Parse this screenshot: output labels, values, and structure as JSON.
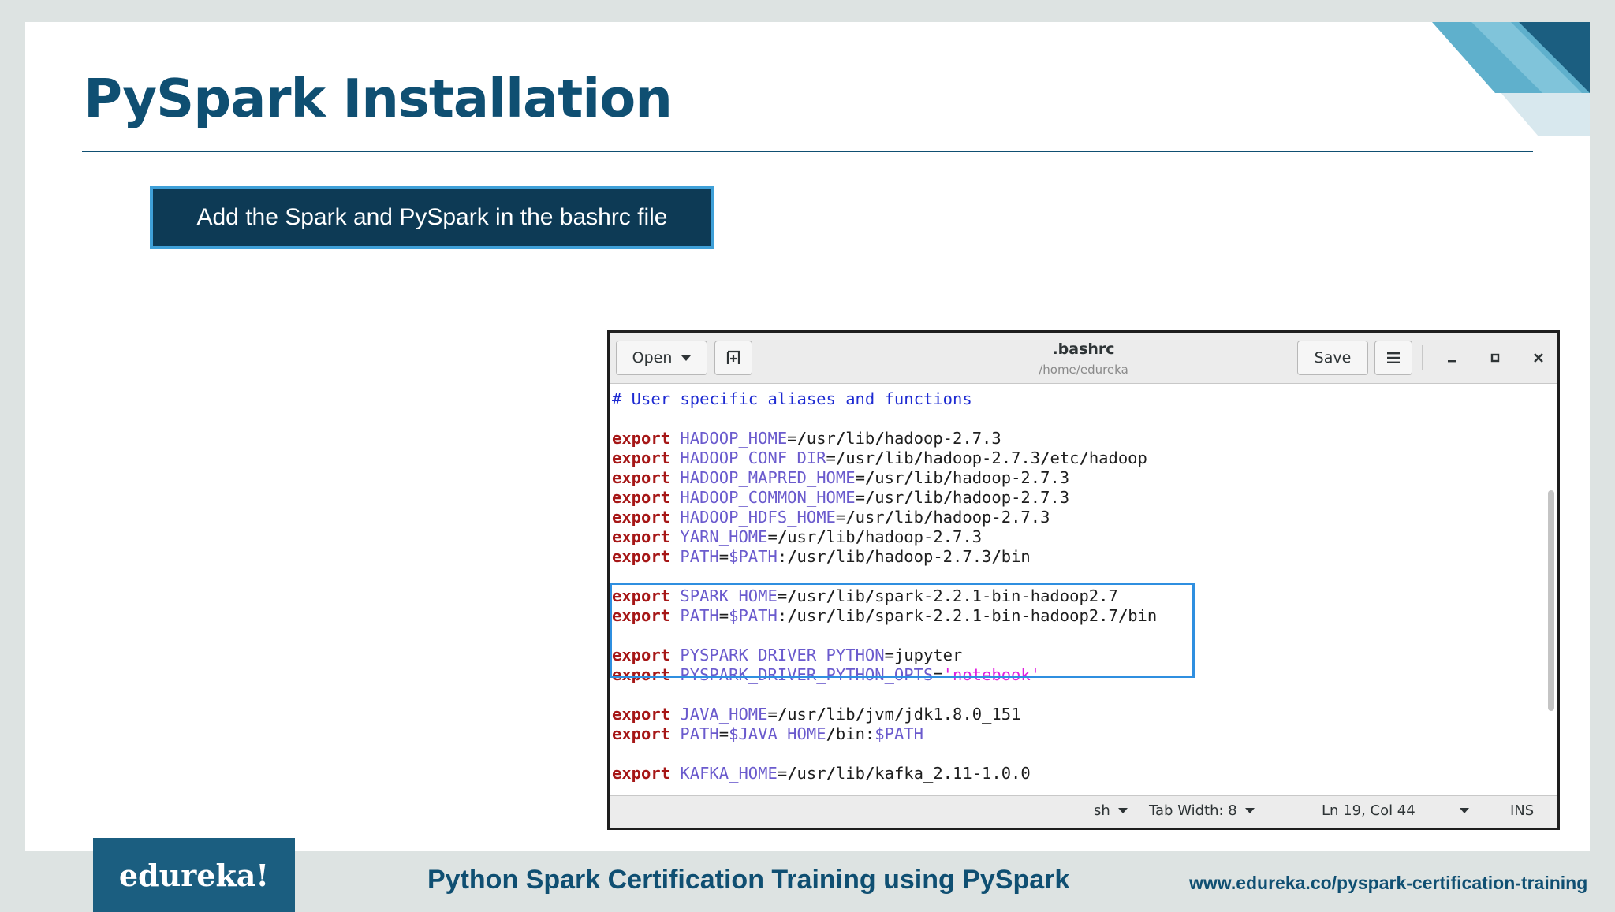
{
  "slide": {
    "title": "PySpark Installation",
    "callout": "Add the Spark and PySpark in the bashrc file"
  },
  "editor": {
    "open_label": "Open",
    "save_label": "Save",
    "new_tab_icon": "new-document-icon",
    "menu_icon": "hamburger-menu-icon",
    "window_title": ".bashrc",
    "window_path": "/home/edureka",
    "window_controls": [
      "minimize",
      "maximize",
      "close"
    ],
    "lines": [
      [
        {
          "t": "# User specific aliases and functions",
          "c": "cm"
        }
      ],
      [],
      [
        {
          "t": "export",
          "c": "kw"
        },
        {
          "t": " "
        },
        {
          "t": "HADOOP_HOME",
          "c": "var"
        },
        {
          "t": "="
        },
        {
          "t": "/",
          "c": "sl"
        },
        {
          "t": "usr"
        },
        {
          "t": "/",
          "c": "sl"
        },
        {
          "t": "lib"
        },
        {
          "t": "/",
          "c": "sl"
        },
        {
          "t": "hadoop-2.7.3"
        }
      ],
      [
        {
          "t": "export",
          "c": "kw"
        },
        {
          "t": " "
        },
        {
          "t": "HADOOP_CONF_DIR",
          "c": "var"
        },
        {
          "t": "="
        },
        {
          "t": "/",
          "c": "sl"
        },
        {
          "t": "usr"
        },
        {
          "t": "/",
          "c": "sl"
        },
        {
          "t": "lib"
        },
        {
          "t": "/",
          "c": "sl"
        },
        {
          "t": "hadoop-2.7.3"
        },
        {
          "t": "/",
          "c": "sl"
        },
        {
          "t": "etc"
        },
        {
          "t": "/",
          "c": "sl"
        },
        {
          "t": "hadoop"
        }
      ],
      [
        {
          "t": "export",
          "c": "kw"
        },
        {
          "t": " "
        },
        {
          "t": "HADOOP_MAPRED_HOME",
          "c": "var"
        },
        {
          "t": "="
        },
        {
          "t": "/",
          "c": "sl"
        },
        {
          "t": "usr"
        },
        {
          "t": "/",
          "c": "sl"
        },
        {
          "t": "lib"
        },
        {
          "t": "/",
          "c": "sl"
        },
        {
          "t": "hadoop-2.7.3"
        }
      ],
      [
        {
          "t": "export",
          "c": "kw"
        },
        {
          "t": " "
        },
        {
          "t": "HADOOP_COMMON_HOME",
          "c": "var"
        },
        {
          "t": "="
        },
        {
          "t": "/",
          "c": "sl"
        },
        {
          "t": "usr"
        },
        {
          "t": "/",
          "c": "sl"
        },
        {
          "t": "lib"
        },
        {
          "t": "/",
          "c": "sl"
        },
        {
          "t": "hadoop-2.7.3"
        }
      ],
      [
        {
          "t": "export",
          "c": "kw"
        },
        {
          "t": " "
        },
        {
          "t": "HADOOP_HDFS_HOME",
          "c": "var"
        },
        {
          "t": "="
        },
        {
          "t": "/",
          "c": "sl"
        },
        {
          "t": "usr"
        },
        {
          "t": "/",
          "c": "sl"
        },
        {
          "t": "lib"
        },
        {
          "t": "/",
          "c": "sl"
        },
        {
          "t": "hadoop-2.7.3"
        }
      ],
      [
        {
          "t": "export",
          "c": "kw"
        },
        {
          "t": " "
        },
        {
          "t": "YARN_HOME",
          "c": "var"
        },
        {
          "t": "="
        },
        {
          "t": "/",
          "c": "sl"
        },
        {
          "t": "usr"
        },
        {
          "t": "/",
          "c": "sl"
        },
        {
          "t": "lib"
        },
        {
          "t": "/",
          "c": "sl"
        },
        {
          "t": "hadoop-2.7.3"
        }
      ],
      [
        {
          "t": "export",
          "c": "kw"
        },
        {
          "t": " "
        },
        {
          "t": "PATH",
          "c": "var"
        },
        {
          "t": "="
        },
        {
          "t": "$PATH",
          "c": "var"
        },
        {
          "t": ":"
        },
        {
          "t": "/",
          "c": "sl"
        },
        {
          "t": "usr"
        },
        {
          "t": "/",
          "c": "sl"
        },
        {
          "t": "lib"
        },
        {
          "t": "/",
          "c": "sl"
        },
        {
          "t": "hadoop-2.7.3"
        },
        {
          "t": "/",
          "c": "sl"
        },
        {
          "t": "bin"
        },
        {
          "t": "",
          "c": "cursor"
        }
      ],
      [],
      [
        {
          "t": "export",
          "c": "kw"
        },
        {
          "t": " "
        },
        {
          "t": "SPARK_HOME",
          "c": "var"
        },
        {
          "t": "="
        },
        {
          "t": "/",
          "c": "sl"
        },
        {
          "t": "usr"
        },
        {
          "t": "/",
          "c": "sl"
        },
        {
          "t": "lib"
        },
        {
          "t": "/",
          "c": "sl"
        },
        {
          "t": "spark-2.2.1-bin-hadoop2.7"
        }
      ],
      [
        {
          "t": "export",
          "c": "kw"
        },
        {
          "t": " "
        },
        {
          "t": "PATH",
          "c": "var"
        },
        {
          "t": "="
        },
        {
          "t": "$PATH",
          "c": "var"
        },
        {
          "t": ":"
        },
        {
          "t": "/",
          "c": "sl"
        },
        {
          "t": "usr"
        },
        {
          "t": "/",
          "c": "sl"
        },
        {
          "t": "lib"
        },
        {
          "t": "/",
          "c": "sl"
        },
        {
          "t": "spark-2.2.1-bin-hadoop2.7"
        },
        {
          "t": "/",
          "c": "sl"
        },
        {
          "t": "bin"
        }
      ],
      [],
      [
        {
          "t": "export",
          "c": "kw"
        },
        {
          "t": " "
        },
        {
          "t": "PYSPARK_DRIVER_PYTHON",
          "c": "var"
        },
        {
          "t": "="
        },
        {
          "t": "jupyter"
        }
      ],
      [
        {
          "t": "export",
          "c": "kw"
        },
        {
          "t": " "
        },
        {
          "t": "PYSPARK_DRIVER_PYTHON_OPTS",
          "c": "var"
        },
        {
          "t": "="
        },
        {
          "t": "'notebook'",
          "c": "str"
        }
      ],
      [],
      [
        {
          "t": "export",
          "c": "kw"
        },
        {
          "t": " "
        },
        {
          "t": "JAVA_HOME",
          "c": "var"
        },
        {
          "t": "="
        },
        {
          "t": "/",
          "c": "sl"
        },
        {
          "t": "usr"
        },
        {
          "t": "/",
          "c": "sl"
        },
        {
          "t": "lib"
        },
        {
          "t": "/",
          "c": "sl"
        },
        {
          "t": "jvm"
        },
        {
          "t": "/",
          "c": "sl"
        },
        {
          "t": "jdk1.8.0_151"
        }
      ],
      [
        {
          "t": "export",
          "c": "kw"
        },
        {
          "t": " "
        },
        {
          "t": "PATH",
          "c": "var"
        },
        {
          "t": "="
        },
        {
          "t": "$JAVA_HOME",
          "c": "var"
        },
        {
          "t": "/",
          "c": "sl"
        },
        {
          "t": "bin"
        },
        {
          "t": ":"
        },
        {
          "t": "$PATH",
          "c": "var"
        }
      ],
      [],
      [
        {
          "t": "export",
          "c": "kw"
        },
        {
          "t": " "
        },
        {
          "t": "KAFKA_HOME",
          "c": "var"
        },
        {
          "t": "="
        },
        {
          "t": "/",
          "c": "sl"
        },
        {
          "t": "usr"
        },
        {
          "t": "/",
          "c": "sl"
        },
        {
          "t": "lib"
        },
        {
          "t": "/",
          "c": "sl"
        },
        {
          "t": "kafka_2.11-1.0.0"
        }
      ]
    ],
    "status": {
      "language": "sh",
      "tab_width": "Tab Width: 8",
      "position": "Ln 19, Col 44",
      "mode": "INS"
    }
  },
  "footer": {
    "logo": "edureka!",
    "course": "Python Spark Certification Training using PySpark",
    "url": "www.edureka.co/pyspark-certification-training"
  },
  "colors": {
    "title": "#0f4f72",
    "callout_bg": "#0d3a55",
    "callout_border": "#3fa0d8",
    "highlight_box": "#2f8fe0",
    "keyword": "#a61717",
    "variable": "#6a5acd",
    "string": "#e01ee0",
    "comment": "#1e2bd2"
  }
}
